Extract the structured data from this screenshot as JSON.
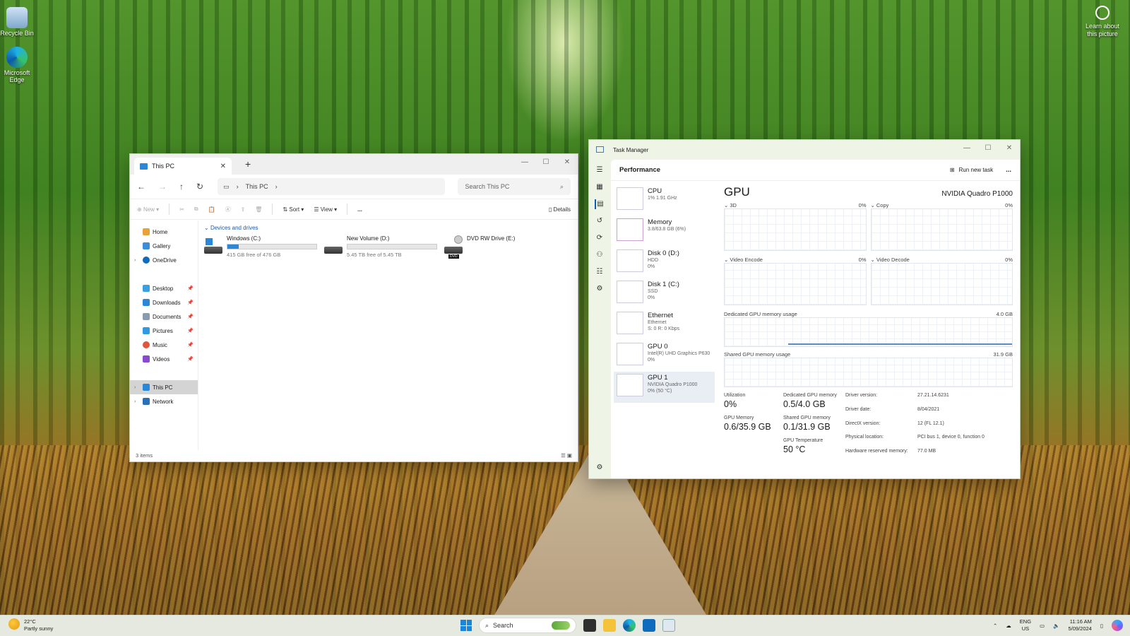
{
  "desktop": {
    "recycle_bin_label": "Recycle Bin",
    "edge_label": "Microsoft Edge",
    "learn_label": "Learn about this picture"
  },
  "explorer": {
    "tab_title": "This PC",
    "breadcrumb": "This PC",
    "search_placeholder": "Search This PC",
    "cmd": {
      "new": "New",
      "sort": "Sort",
      "view": "View",
      "more": "...",
      "details": "Details"
    },
    "nav": {
      "home": "Home",
      "gallery": "Gallery",
      "onedrive": "OneDrive",
      "desktop": "Desktop",
      "downloads": "Downloads",
      "documents": "Documents",
      "pictures": "Pictures",
      "music": "Music",
      "videos": "Videos",
      "this_pc": "This PC",
      "network": "Network"
    },
    "section": "Devices and drives",
    "drives": [
      {
        "name": "Windows (C:)",
        "free": "415 GB free of 476 GB",
        "used_fraction": 0.13
      },
      {
        "name": "New Volume (D:)",
        "free": "5.45 TB free of 5.45 TB",
        "used_fraction": 0.0
      },
      {
        "name": "DVD RW Drive (E:)",
        "badge": "DVD"
      }
    ],
    "status": "3 items"
  },
  "taskmanager": {
    "title": "Task Manager",
    "section": "Performance",
    "run_new_task": "Run new task",
    "more": "...",
    "items": [
      {
        "title": "CPU",
        "sub1": "1% 1.91 GHz",
        "sub2": ""
      },
      {
        "title": "Memory",
        "sub1": "3.8/63.8 GB (6%)",
        "sub2": ""
      },
      {
        "title": "Disk 0 (D:)",
        "sub1": "HDD",
        "sub2": "0%"
      },
      {
        "title": "Disk 1 (C:)",
        "sub1": "SSD",
        "sub2": "0%"
      },
      {
        "title": "Ethernet",
        "sub1": "Ethernet",
        "sub2": "S: 0 R: 0 Kbps"
      },
      {
        "title": "GPU 0",
        "sub1": "Intel(R) UHD Graphics P630",
        "sub2": "0%"
      },
      {
        "title": "GPU 1",
        "sub1": "NVIDIA Quadro P1000",
        "sub2": "0% (50 °C)"
      }
    ],
    "gpu": {
      "heading": "GPU",
      "model": "NVIDIA Quadro P1000",
      "graphs": [
        {
          "label": "3D",
          "pct": "0%"
        },
        {
          "label": "Copy",
          "pct": "0%"
        },
        {
          "label": "Video Encode",
          "pct": "0%"
        },
        {
          "label": "Video Decode",
          "pct": "0%"
        }
      ],
      "dedicated_label": "Dedicated GPU memory usage",
      "dedicated_max": "4.0 GB",
      "shared_label": "Shared GPU memory usage",
      "shared_max": "31.9 GB",
      "stats": {
        "utilization_label": "Utilization",
        "utilization": "0%",
        "gpu_memory_label": "GPU Memory",
        "gpu_memory": "0.6/35.9 GB",
        "dedicated_label": "Dedicated GPU memory",
        "dedicated": "0.5/4.0 GB",
        "shared_label": "Shared GPU memory",
        "shared": "0.1/31.9 GB",
        "temp_label": "GPU Temperature",
        "temp": "50 °C"
      },
      "info": [
        {
          "k": "Driver version:",
          "v": "27.21.14.6231"
        },
        {
          "k": "Driver date:",
          "v": "8/04/2021"
        },
        {
          "k": "DirectX version:",
          "v": "12 (FL 12.1)"
        },
        {
          "k": "Physical location:",
          "v": "PCI bus 1, device 0, function 0"
        },
        {
          "k": "Hardware reserved memory:",
          "v": "77.0 MB"
        }
      ]
    }
  },
  "taskbar": {
    "temp": "22°C",
    "weather": "Partly sunny",
    "search": "Search",
    "lang1": "ENG",
    "lang2": "US",
    "time": "11:16 AM",
    "date": "5/09/2024"
  }
}
